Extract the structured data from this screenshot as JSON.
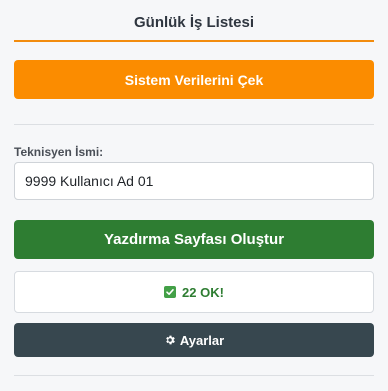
{
  "header": {
    "title": "Günlük İş Listesi"
  },
  "actions": {
    "fetch_label": "Sistem Verilerini Çek",
    "print_label": "Yazdırma Sayfası Oluştur",
    "settings_label": "Ayarlar"
  },
  "technician": {
    "label": "Teknisyen İsmi:",
    "value": "9999 Kullanıcı Ad 01"
  },
  "status": {
    "text": "22 OK!",
    "icon": "check-icon"
  },
  "colors": {
    "accent": "#fb8c00",
    "success": "#2e7d32",
    "settings": "#37474f"
  }
}
